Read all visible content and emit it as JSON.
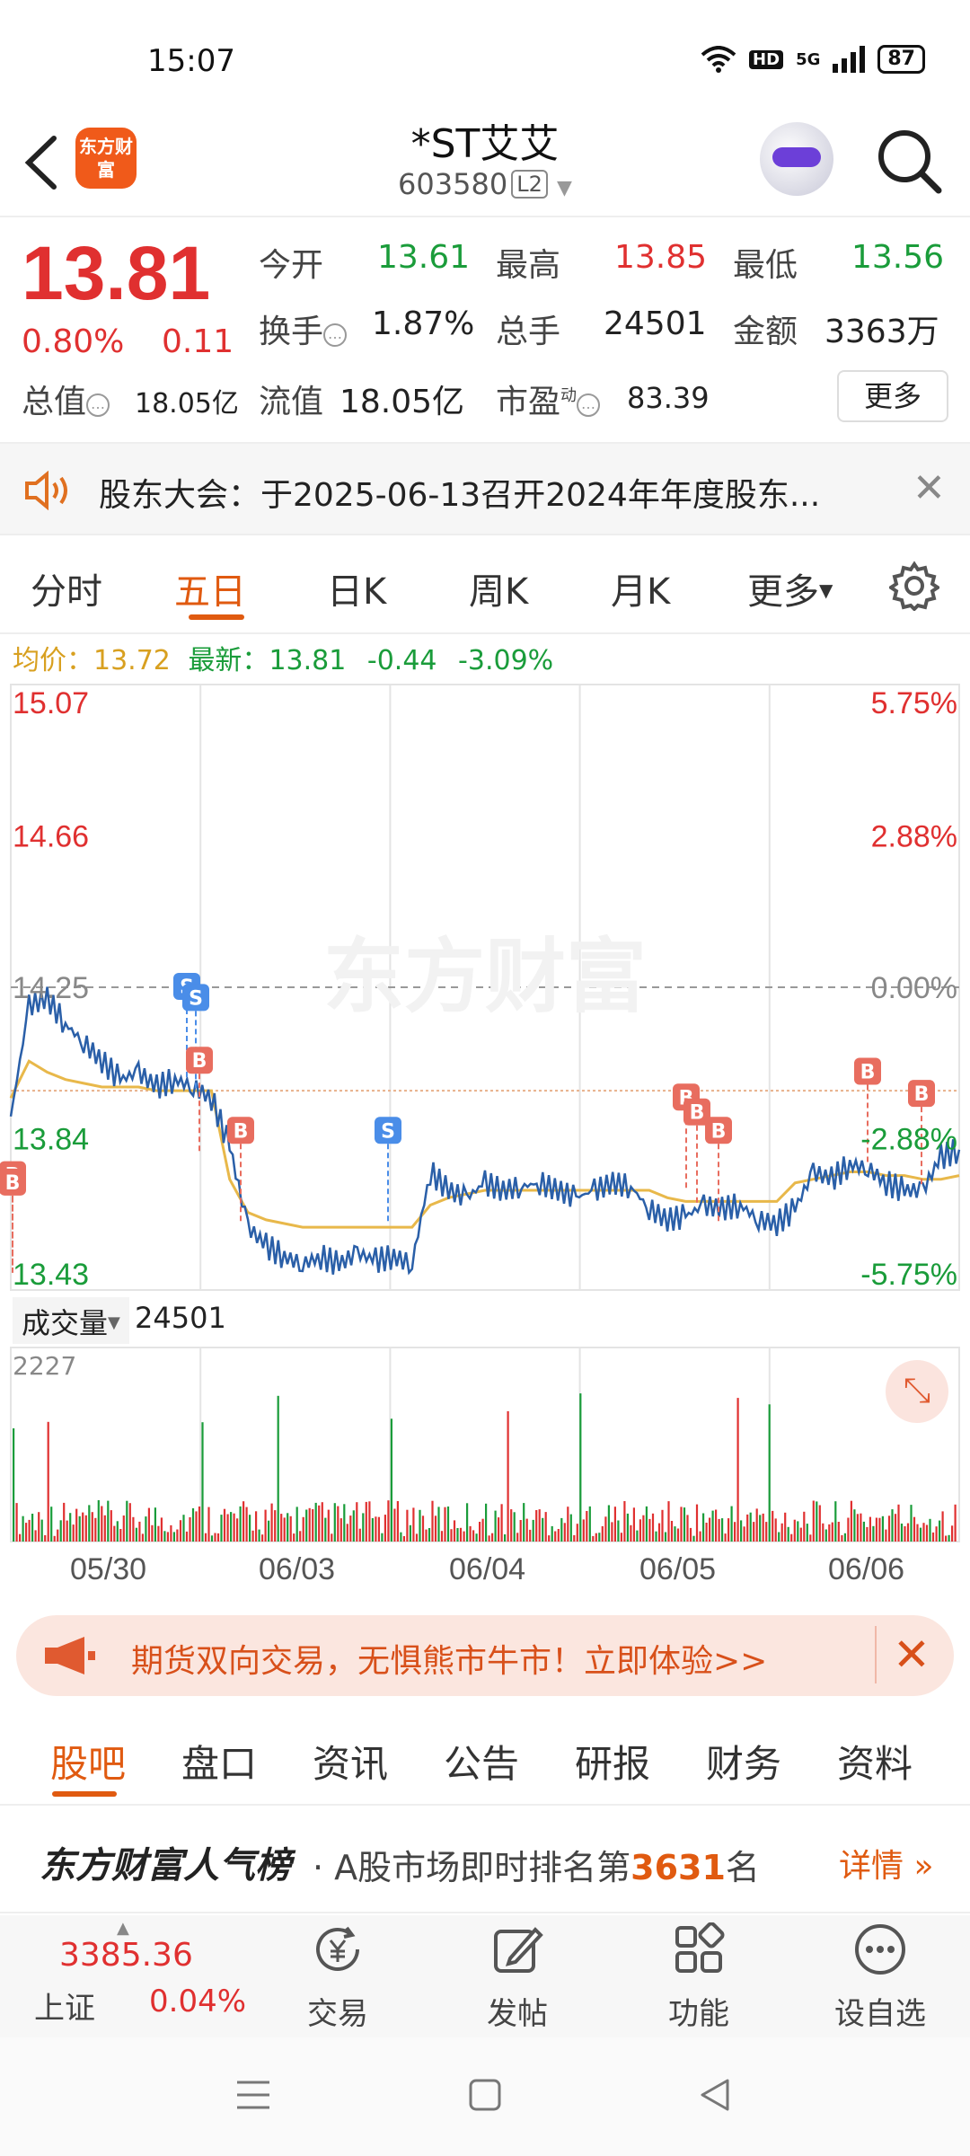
{
  "status_bar": {
    "time": "15:07",
    "network": "5G",
    "hd": "HD",
    "battery": "87"
  },
  "header": {
    "logo_text": "东方财富",
    "stock_name": "*ST艾艾",
    "stock_code": "603580",
    "level": "L2"
  },
  "quote": {
    "price": "13.81",
    "change_pct": "0.80%",
    "change": "0.11",
    "market_cap_label": "总值",
    "market_cap": "18.05亿",
    "open_label": "今开",
    "open": "13.61",
    "high_label": "最高",
    "high": "13.85",
    "low_label": "最低",
    "low": "13.56",
    "turnover_label": "换手",
    "turnover": "1.87%",
    "volume_label": "总手",
    "volume": "24501",
    "amount_label": "金额",
    "amount": "3363万",
    "float_cap_label": "流值",
    "float_cap": "18.05亿",
    "pe_label": "市盈",
    "pe_sup": "动",
    "pe": "83.39",
    "more_label": "更多"
  },
  "notice": {
    "text": "股东大会：于2025-06-13召开2024年年度股东..."
  },
  "chart_tabs": [
    "分时",
    "五日",
    "日K",
    "周K",
    "月K",
    "更多"
  ],
  "avg_row": {
    "avg_label": "均价：",
    "avg": "13.72",
    "latest_label": "最新：",
    "latest": "13.81",
    "chg": "-0.44",
    "chg_pct": "-3.09%"
  },
  "chart_data": {
    "type": "line",
    "y_left_labels": [
      "15.07",
      "14.66",
      "14.25",
      "13.84",
      "13.43"
    ],
    "y_right_labels": [
      "5.75%",
      "2.88%",
      "0.00%",
      "-2.88%",
      "-5.75%"
    ],
    "x_labels": [
      "05/30",
      "06/03",
      "06/04",
      "06/05",
      "06/06"
    ],
    "watermark": "东方财富",
    "ylim": [
      13.43,
      15.07
    ],
    "prev_close": 14.25,
    "series": [
      {
        "values": [
          13.9,
          14.2,
          14.22,
          14.15,
          14.1,
          14.05,
          14.0,
          14.02,
          13.98,
          14.0,
          13.98,
          13.95,
          13.82,
          13.6,
          13.55,
          13.52,
          13.5,
          13.52,
          13.5,
          13.53,
          13.51,
          13.52,
          13.5,
          13.75,
          13.7,
          13.68,
          13.72,
          13.7,
          13.71,
          13.72,
          13.7,
          13.68,
          13.7,
          13.72,
          13.71,
          13.65,
          13.62,
          13.63,
          13.66,
          13.65,
          13.66,
          13.62,
          13.61,
          13.65,
          13.75,
          13.73,
          13.77,
          13.76,
          13.72,
          13.7,
          13.7,
          13.79,
          13.81
        ]
      },
      {
        "values": [
          13.95,
          14.05,
          14.02,
          14.0,
          13.99,
          13.98,
          13.98,
          13.98,
          13.97,
          13.97,
          13.97,
          13.97,
          13.73,
          13.64,
          13.62,
          13.61,
          13.6,
          13.6,
          13.6,
          13.6,
          13.6,
          13.6,
          13.6,
          13.66,
          13.68,
          13.69,
          13.7,
          13.7,
          13.7,
          13.7,
          13.7,
          13.7,
          13.7,
          13.7,
          13.7,
          13.7,
          13.68,
          13.67,
          13.67,
          13.67,
          13.67,
          13.67,
          13.67,
          13.72,
          13.73,
          13.74,
          13.75,
          13.75,
          13.74,
          13.74,
          13.73,
          13.73,
          13.74
        ]
      }
    ],
    "markers": [
      {
        "label": "B",
        "color": "#e86d5f"
      },
      {
        "label": "B",
        "color": "#e86d5f"
      },
      {
        "label": "S",
        "color": "#4a8de8"
      },
      {
        "label": "S",
        "color": "#4a8de8"
      },
      {
        "label": "B",
        "color": "#e86d5f"
      },
      {
        "label": "B",
        "color": "#e86d5f"
      },
      {
        "label": "S",
        "color": "#4a8de8"
      },
      {
        "label": "B",
        "color": "#e86d5f"
      },
      {
        "label": "B",
        "color": "#e86d5f"
      },
      {
        "label": "B",
        "color": "#e86d5f"
      },
      {
        "label": "B",
        "color": "#e86d5f"
      },
      {
        "label": "B",
        "color": "#e86d5f"
      }
    ]
  },
  "volume": {
    "label": "成交量",
    "value": "24501",
    "max": "2227"
  },
  "promo": {
    "text": "期货双向交易，无惧熊市牛市！立即体验>>"
  },
  "bottom_tabs": [
    "股吧",
    "盘口",
    "资讯",
    "公告",
    "研报",
    "财务",
    "资料"
  ],
  "popularity": {
    "brand": "东方财富人气榜",
    "text_prefix": "· A股市场即时排名第",
    "rank": "3631",
    "text_suffix": "名",
    "detail": "详情"
  },
  "bottom_bar": {
    "index_value": "3385.36",
    "index_name": "上证",
    "index_pct": "0.04%",
    "items": [
      "交易",
      "发帖",
      "功能",
      "设自选"
    ]
  },
  "colors": {
    "up": "#e03030",
    "down": "#1a9c3a",
    "accent": "#e05a10",
    "price_line": "#2a5fa8",
    "avg_line": "#e8b84a"
  }
}
